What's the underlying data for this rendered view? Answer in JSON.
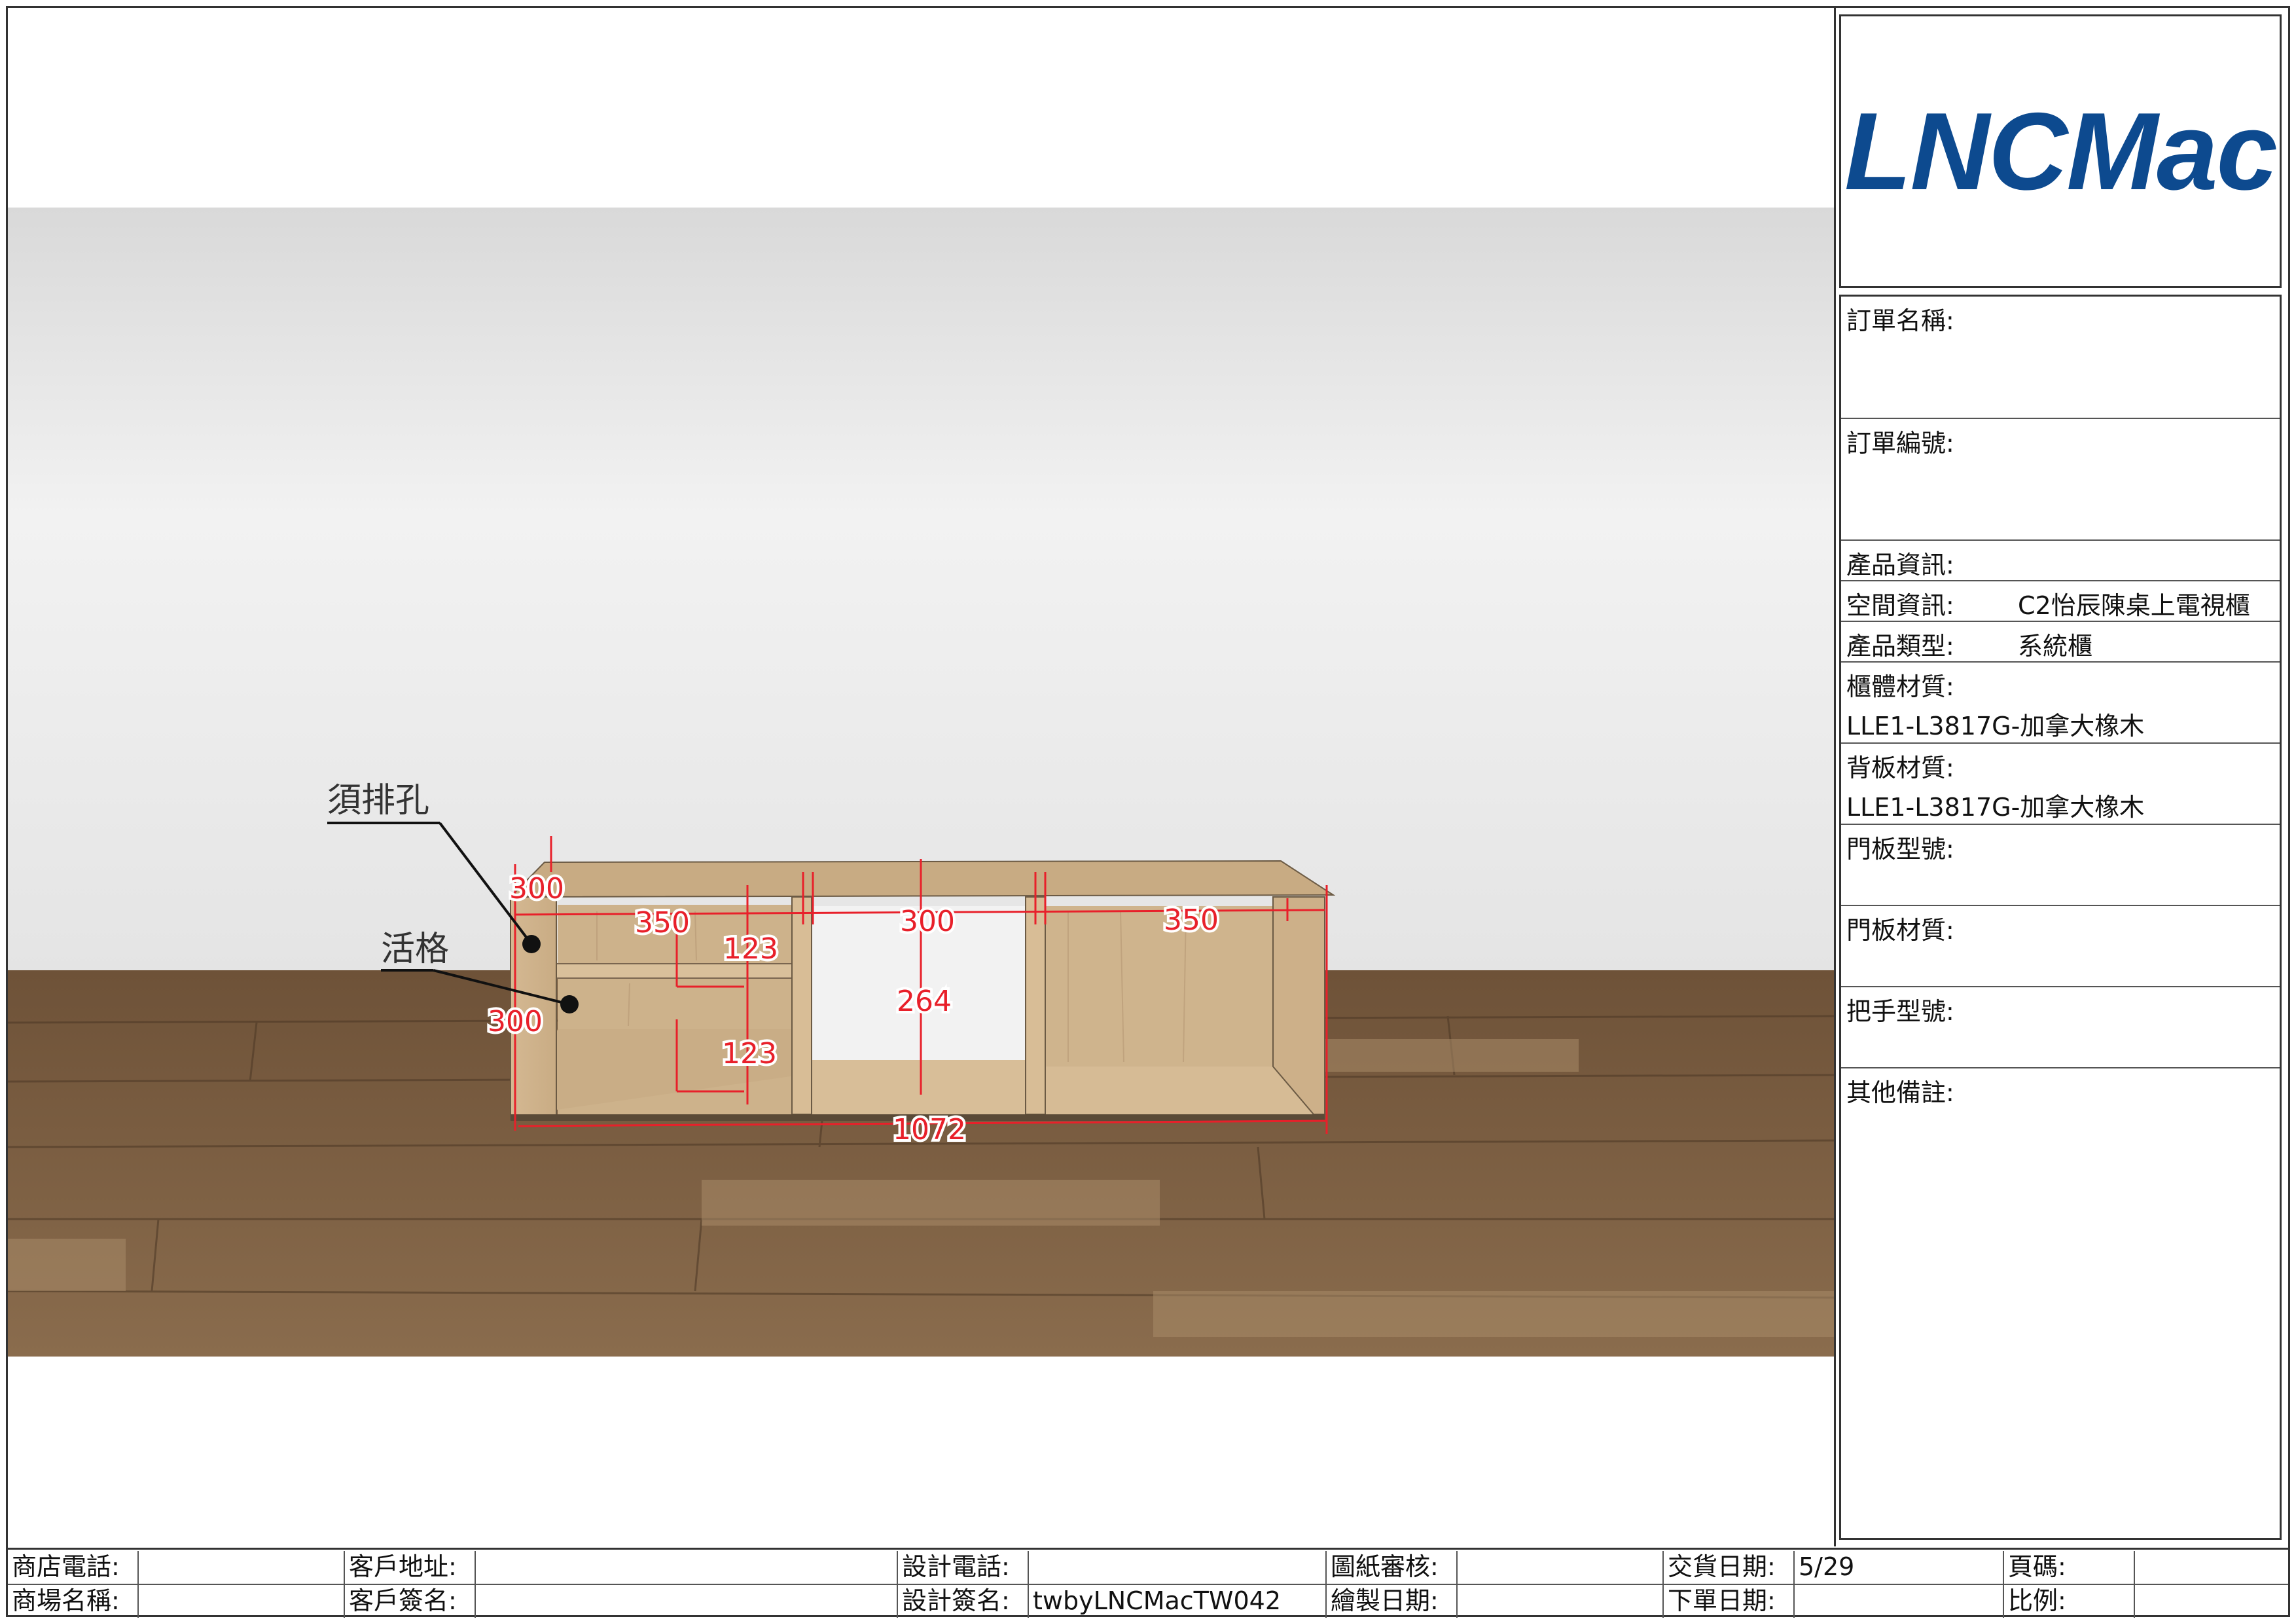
{
  "brand": {
    "logo_text": "LNCMac",
    "logo_color": "#0d4a8f"
  },
  "drawing": {
    "annotations": {
      "drill_label": "須排孔",
      "shelf_label": "活格"
    },
    "dimensions": {
      "depth_top": "300",
      "width_left": "350",
      "width_mid": "300",
      "width_right": "350",
      "shelf_upper": "123",
      "shelf_lower": "123",
      "height_left": "300",
      "height_mid": "264",
      "total_width": "1072"
    },
    "colors": {
      "dimension": "#e8202a",
      "wood": "#d8bf99",
      "floor": "#7a5f43",
      "wall": "#e9e9e9"
    }
  },
  "info_panel": {
    "order_name_label": "訂單名稱:",
    "order_no_label": "訂單編號:",
    "product_info_label": "產品資訊:",
    "space_info_label": "空間資訊:",
    "space_info_value": "C2怡辰陳桌上電視櫃",
    "product_type_label": "產品類型:",
    "product_type_value": "系統櫃",
    "body_material_label": "櫃體材質:",
    "body_material_value": "LLE1-L3817G-加拿大橡木",
    "back_material_label": "背板材質:",
    "back_material_value": "LLE1-L3817G-加拿大橡木",
    "door_model_label": "門板型號:",
    "door_material_label": "門板材質:",
    "handle_model_label": "把手型號:",
    "remarks_label": "其他備註:"
  },
  "footer": {
    "shop_phone_label": "商店電話:",
    "mall_name_label": "商場名稱:",
    "client_address_label": "客戶地址:",
    "client_sign_label": "客戶簽名:",
    "design_phone_label": "設計電話:",
    "design_sign_label": "設計簽名:",
    "design_sign_value": "twbyLNCMacTW042",
    "drawing_review_label": "圖紙審核:",
    "drawing_date_label": "繪製日期:",
    "delivery_date_label": "交貨日期:",
    "delivery_date_value": "5/29",
    "order_date_label": "下單日期:",
    "page_label": "頁碼:",
    "scale_label": "比例:"
  }
}
